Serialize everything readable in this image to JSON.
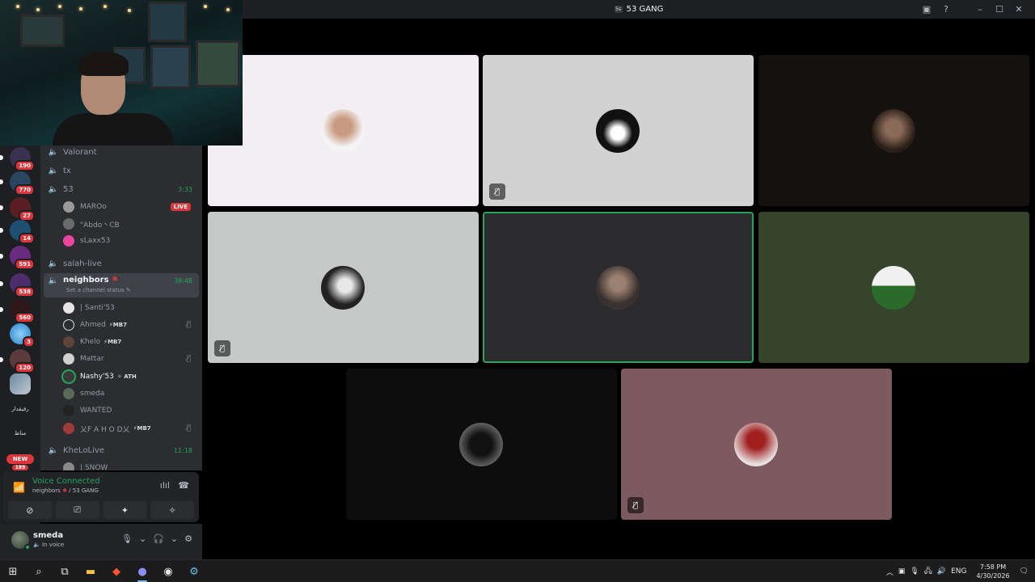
{
  "window": {
    "server_icon_text": "5s",
    "title": "53 GANG"
  },
  "rail": {
    "badges": [
      "190",
      "770",
      "27",
      "14",
      "591",
      "538",
      "560",
      "3",
      "120"
    ],
    "text_servers": [
      "رفيقدار",
      "مناظ"
    ],
    "new_label": "NEW",
    "last_badge": "189"
  },
  "channels": {
    "items": [
      {
        "name": "Valorant"
      },
      {
        "name": "tx"
      },
      {
        "name": "53",
        "duration": "3:33"
      },
      {
        "name": "salah-live"
      },
      {
        "name": "neighbors",
        "duration": "38:48",
        "status": "Set a channel status"
      },
      {
        "name": "KheLoLive",
        "duration": "11:18"
      }
    ],
    "users_53": [
      {
        "name": "MAROo",
        "badge": "LIVE"
      },
      {
        "name": "\"Abdo丶CB"
      },
      {
        "name": "sLaxx53"
      }
    ],
    "users_neighbors": [
      {
        "name": "| Santi'53",
        "tag": ""
      },
      {
        "name": "Ahmed",
        "tag": "⚡MB7"
      },
      {
        "name": "Khelo",
        "tag": "⚡MB7"
      },
      {
        "name": "Mattar",
        "tag": ""
      },
      {
        "name": "Nashy'53",
        "tag": "✧ ATH"
      },
      {
        "name": "smeda",
        "tag": ""
      },
      {
        "name": "WANTED",
        "tag": ""
      },
      {
        "name": "乂F A H O D乂",
        "tag": "⚡MB7"
      }
    ],
    "users_khelolive": [
      {
        "name": "| SNOW"
      }
    ]
  },
  "voice_panel": {
    "title": "Voice Connected",
    "channel": "neighbors",
    "server": "/ 53 GANG"
  },
  "user_bar": {
    "name": "smeda",
    "status": "In voice"
  },
  "tiles": [
    {
      "bg": "#f2eef3",
      "muted": false
    },
    {
      "bg": "#d2d2d2",
      "muted": true
    },
    {
      "bg": "#14110f",
      "muted": false
    },
    {
      "bg": "#c6c8c8",
      "muted": true
    },
    {
      "bg": "#2b2a2d",
      "muted": false,
      "speaking": true
    },
    {
      "bg": "#36442c",
      "muted": false
    },
    {
      "bg": "#0d0d0d",
      "muted": false
    },
    {
      "bg": "#7d5a60",
      "muted": true
    }
  ],
  "taskbar": {
    "lang": "ENG",
    "time": "7:58 PM",
    "date": "4/30/2026"
  },
  "colors": {
    "accent_green": "#23a55a",
    "danger_red": "#da373c",
    "sidebar": "#2b2d31",
    "rail": "#1e1f22"
  }
}
